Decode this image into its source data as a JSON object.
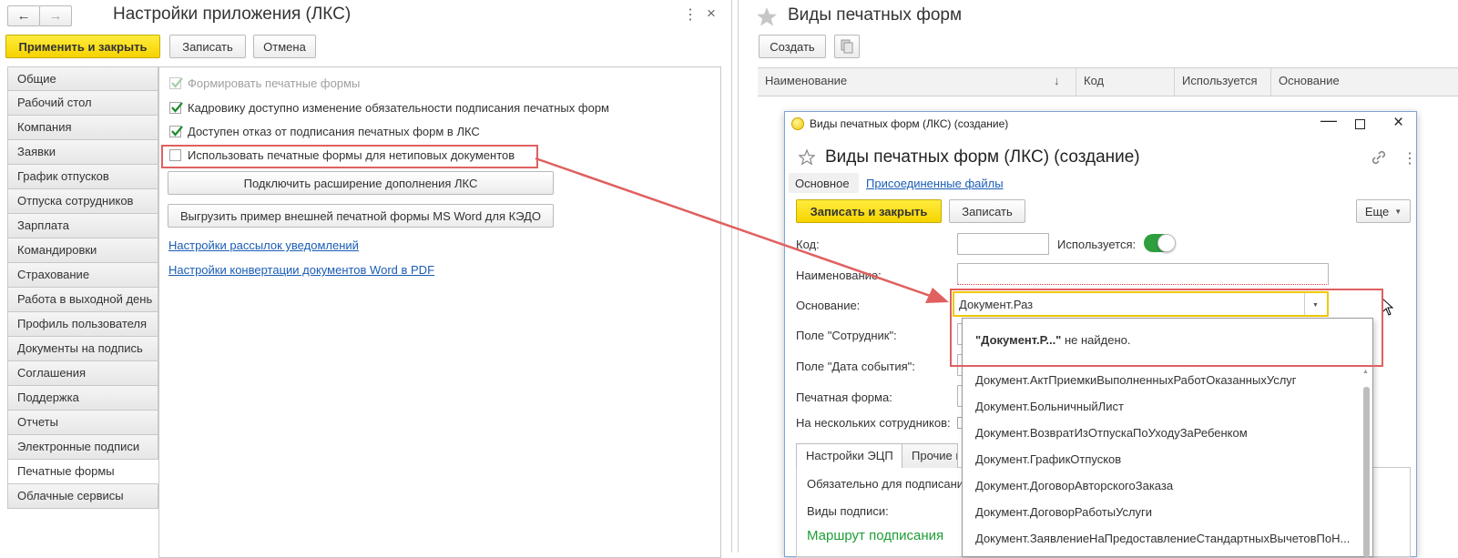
{
  "left": {
    "title": "Настройки приложения (ЛКС)",
    "apply_close": "Применить и закрыть",
    "save": "Записать",
    "cancel": "Отмена",
    "nav": [
      "Общие",
      "Рабочий стол",
      "Компания",
      "Заявки",
      "График отпусков",
      "Отпуска сотрудников",
      "Зарплата",
      "Командировки",
      "Страхование",
      "Работа в выходной день",
      "Профиль пользователя",
      "Документы на подпись",
      "Соглашения",
      "Поддержка",
      "Отчеты",
      "Электронные подписи",
      "Печатные формы",
      "Облачные сервисы"
    ],
    "active_nav_index": 16,
    "options": {
      "form_print": "Формировать печатные формы",
      "hr_change": "Кадровику доступно изменение обязательности подписания печатных форм",
      "refusal": "Доступен отказ от подписания печатных форм в ЛКС",
      "custom_docs": "Использовать печатные формы для нетиповых документов"
    },
    "btn_extension": "Подключить расширение дополнения ЛКС",
    "btn_export": "Выгрузить пример внешней печатной формы MS Word для КЭДО",
    "link_notifications": "Настройки рассылок уведомлений",
    "link_convert": "Настройки конвертации документов Word в PDF"
  },
  "right": {
    "title": "Виды печатных форм",
    "create": "Создать",
    "columns": {
      "name": "Наименование",
      "code": "Код",
      "used": "Используется",
      "basis": "Основание"
    },
    "sort_arrow": "↓"
  },
  "dialog": {
    "window_title": "Виды печатных форм (ЛКС) (создание)",
    "heading": "Виды печатных форм (ЛКС) (создание)",
    "tab_main": "Основное",
    "tab_files": "Присоединенные файлы",
    "save_close": "Записать и закрыть",
    "save": "Записать",
    "more": "Еще",
    "code_label": "Код:",
    "used_label": "Используется:",
    "name_label": "Наименование:",
    "basis_label": "Основание:",
    "basis_value": "Документ.Раз",
    "employee_label": "Поле \"Сотрудник\":",
    "event_date_label": "Поле \"Дата события\":",
    "print_form_label": "Печатная форма:",
    "multiple_label": "На нескольких сотрудников:",
    "subtab_ecp": "Настройки ЭЦП",
    "subtab_other": "Прочие н",
    "required_label": "Обязательно для подписани",
    "sign_types_label": "Виды подписи:",
    "route_label": "Маршрут подписания",
    "not_found_bold": "\"Документ.Р...\"",
    "not_found_rest": " не найдено.",
    "dropdown_items": [
      "Документ.АктПриемкиВыполненныхРаботОказанныхУслуг",
      "Документ.БольничныйЛист",
      "Документ.ВозвратИзОтпускаПоУходуЗаРебенком",
      "Документ.ГрафикОтпусков",
      "Документ.ДоговорАвторскогоЗаказа",
      "Документ.ДоговорРаботыУслуги",
      "Документ.ЗаявлениеНаПредоставлениеСтандартныхВычетовПоН..."
    ]
  },
  "colors": {
    "accent_yellow": "#f5d300",
    "highlight_red": "#e53e3e",
    "link_blue": "#1a5db5",
    "toggle_green": "#2e9f3e",
    "route_green": "#1f9d36"
  }
}
